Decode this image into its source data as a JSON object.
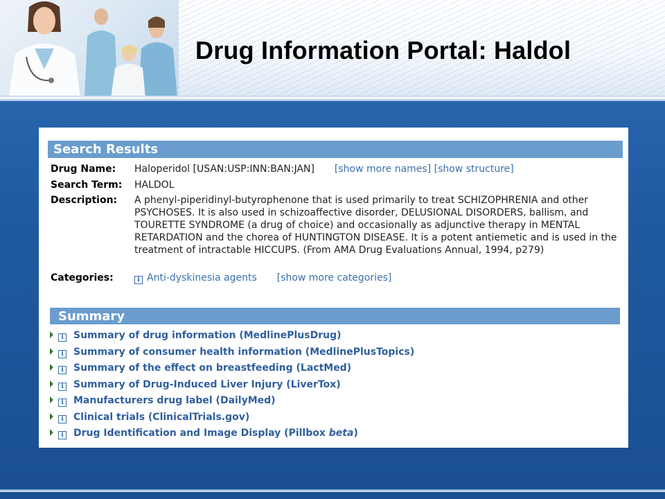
{
  "header": {
    "title": "Drug Information Portal: Haldol"
  },
  "search_results": {
    "section_title": "Search Results",
    "drug_name_label": "Drug Name:",
    "drug_name_value": "Haloperidol [USAN:USP:INN:BAN:JAN]",
    "show_more_names": "[show more names]",
    "show_structure": "[show structure]",
    "search_term_label": "Search Term:",
    "search_term_value": "HALDOL",
    "description_label": "Description:",
    "description_value": "A phenyl-piperidinyl-butyrophenone that is used primarily to treat SCHIZOPHRENIA and other PSYCHOSES. It is also used in schizoaffective disorder, DELUSIONAL DISORDERS, ballism, and TOURETTE SYNDROME (a drug of choice) and occasionally as adjunctive therapy in MENTAL RETARDATION and the chorea of HUNTINGTON DISEASE. It is a potent antiemetic and is used in the treatment of intractable HICCUPS. (From AMA Drug Evaluations Annual, 1994, p279)",
    "categories_label": "Categories:",
    "category_value": "Anti-dyskinesia agents",
    "show_more_categories": "[show more categories]"
  },
  "summary": {
    "section_title": "Summary",
    "items": [
      {
        "label": "Summary of drug information (MedlinePlusDrug)"
      },
      {
        "label": "Summary of consumer health information (MedlinePlusTopics)"
      },
      {
        "label": "Summary of the effect on breastfeeding (LactMed)"
      },
      {
        "label": "Summary of Drug-Induced Liver Injury (LiverTox)"
      },
      {
        "label": "Manufacturers drug label (DailyMed)"
      },
      {
        "label": "Clinical trials (ClinicalTrials.gov)"
      },
      {
        "label_prefix": "Drug Identification and Image Display (Pillbox ",
        "label_italic": "beta",
        "label_suffix": ")"
      }
    ]
  },
  "icons": {
    "info": "info-icon",
    "expand": "triangle-right-icon"
  },
  "colors": {
    "section_bar": "#6a9dcd",
    "link": "#3a6fae",
    "summary_link": "#2f5f9e",
    "page_background": "#1f5aa0"
  }
}
